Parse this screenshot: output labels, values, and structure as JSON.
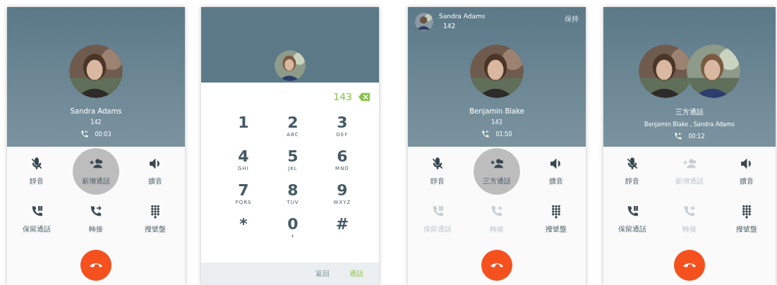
{
  "screens": [
    {
      "kind": "call",
      "title": "Sandra Adams",
      "subtitle": "142",
      "duration": "00:03",
      "actions": [
        {
          "kind": "mute",
          "label": "靜音",
          "disabled": false,
          "selected": false
        },
        {
          "kind": "add-call",
          "label": "新增通話",
          "disabled": false,
          "selected": true
        },
        {
          "kind": "speaker",
          "label": "擴音",
          "disabled": false,
          "selected": false
        },
        {
          "kind": "hold",
          "label": "保留通話",
          "disabled": false,
          "selected": false
        },
        {
          "kind": "transfer",
          "label": "轉接",
          "disabled": false,
          "selected": false
        },
        {
          "kind": "dialpad",
          "label": "撥號盤",
          "disabled": false,
          "selected": false
        }
      ]
    },
    {
      "kind": "dialpad",
      "number": "143",
      "keys": [
        {
          "digit": "1"
        },
        {
          "digit": "2",
          "letters": "ABC"
        },
        {
          "digit": "3",
          "letters": "DEF"
        },
        {
          "digit": "4",
          "letters": "GHI"
        },
        {
          "digit": "5",
          "letters": "JKL"
        },
        {
          "digit": "6",
          "letters": "MNO"
        },
        {
          "digit": "7",
          "letters": "PQRS"
        },
        {
          "digit": "8",
          "letters": "TUV"
        },
        {
          "digit": "9",
          "letters": "WXYZ"
        },
        {
          "digit": "*"
        },
        {
          "digit": "0",
          "letters": "+"
        },
        {
          "digit": "#"
        }
      ],
      "buttons": [
        {
          "label": "返回",
          "primary": false
        },
        {
          "label": "通話",
          "primary": true
        }
      ]
    },
    {
      "kind": "call",
      "held": {
        "name": "Sandra Adams",
        "number": "142",
        "status": "保持"
      },
      "title": "Benjamin Blake",
      "subtitle": "143",
      "duration": "01:50",
      "actions": [
        {
          "kind": "mute",
          "label": "靜音",
          "disabled": false,
          "selected": false
        },
        {
          "kind": "add-call",
          "label": "三方通話",
          "disabled": false,
          "selected": true
        },
        {
          "kind": "speaker",
          "label": "擴音",
          "disabled": false,
          "selected": false
        },
        {
          "kind": "hold",
          "label": "保留通話",
          "disabled": true,
          "selected": false
        },
        {
          "kind": "transfer",
          "label": "轉接",
          "disabled": true,
          "selected": false
        },
        {
          "kind": "dialpad",
          "label": "撥號盤",
          "disabled": false,
          "selected": false
        }
      ]
    },
    {
      "kind": "call",
      "title": "三方通話",
      "subtitle": "Benjamin Blake , Sandra Adams",
      "duration": "00:12",
      "actions": [
        {
          "kind": "mute",
          "label": "靜音",
          "disabled": false,
          "selected": false
        },
        {
          "kind": "add-call",
          "label": "新增通話",
          "disabled": true,
          "selected": false
        },
        {
          "kind": "speaker",
          "label": "擴音",
          "disabled": false,
          "selected": false
        },
        {
          "kind": "hold",
          "label": "保留通話",
          "disabled": false,
          "selected": false
        },
        {
          "kind": "transfer",
          "label": "轉接",
          "disabled": true,
          "selected": false
        },
        {
          "kind": "dialpad",
          "label": "撥號盤",
          "disabled": false,
          "selected": false
        }
      ]
    }
  ]
}
